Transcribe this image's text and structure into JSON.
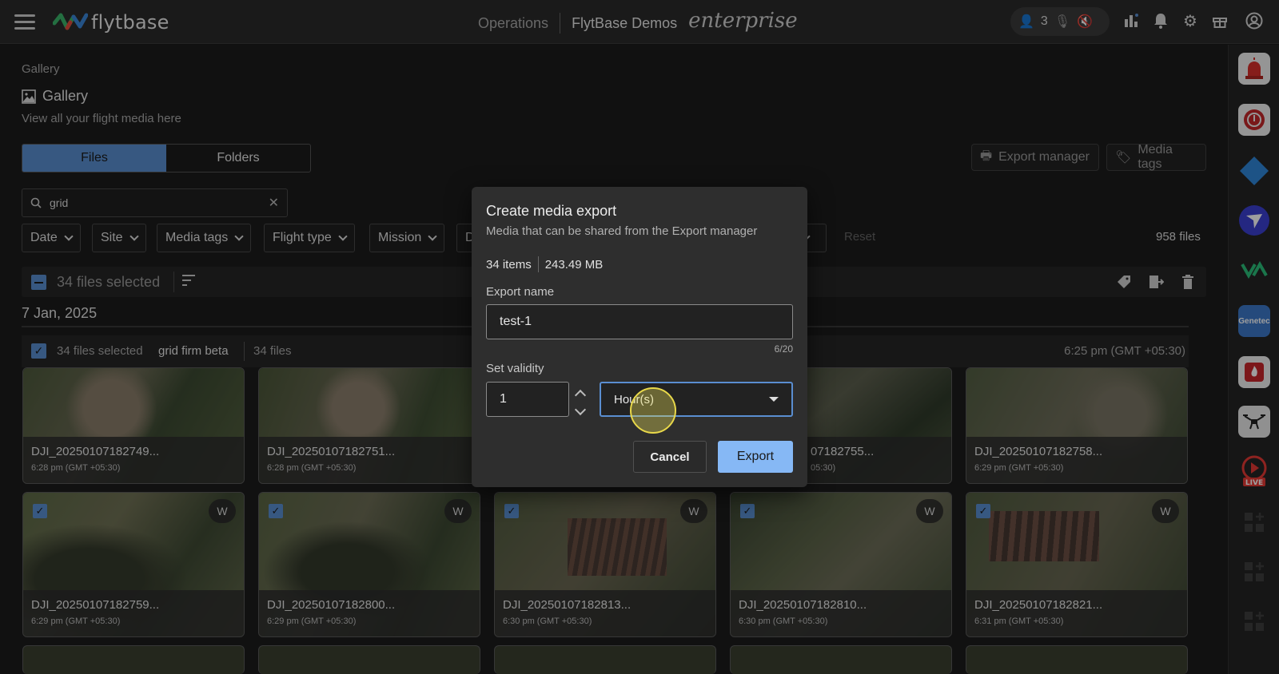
{
  "topbar": {
    "logo_text": "flytbase",
    "nav_operations": "Operations",
    "nav_org": "FlytBase Demos",
    "nav_enterprise": "enterprise",
    "user_count": "3"
  },
  "page": {
    "breadcrumb": "Gallery",
    "title": "Gallery",
    "subtitle": "View all your flight media here"
  },
  "tabs": [
    {
      "label": "Files",
      "active": true
    },
    {
      "label": "Folders",
      "active": false
    }
  ],
  "top_buttons": {
    "export_manager": "Export manager",
    "media_tags": "Media tags"
  },
  "search": {
    "value": "grid"
  },
  "filters": [
    "Date",
    "Site",
    "Media tags",
    "Flight type",
    "Mission",
    "D"
  ],
  "reset_label": "Reset",
  "file_count": "958 files",
  "selection": {
    "label": "34 files selected"
  },
  "date_heading": "7 Jan, 2025",
  "group": {
    "selected": "34 files selected",
    "name": "grid firm beta",
    "count": "34 files",
    "time": "6:25 pm (GMT +05:30)"
  },
  "cards_row1": [
    {
      "name": "DJI_20250107182749...",
      "time": "6:28 pm (GMT +05:30)"
    },
    {
      "name": "DJI_20250107182751...",
      "time": "6:28 pm (GMT +05:30)"
    },
    {
      "name": "",
      "time": ""
    },
    {
      "name": "07182755...",
      "time": "05:30)"
    },
    {
      "name": "DJI_20250107182758...",
      "time": "6:29 pm (GMT +05:30)"
    }
  ],
  "cards_row2": [
    {
      "name": "DJI_20250107182759...",
      "time": "6:29 pm (GMT +05:30)",
      "badge": "W"
    },
    {
      "name": "DJI_20250107182800...",
      "time": "6:29 pm (GMT +05:30)",
      "badge": "W"
    },
    {
      "name": "DJI_20250107182813...",
      "time": "6:30 pm (GMT +05:30)",
      "badge": "W"
    },
    {
      "name": "DJI_20250107182810...",
      "time": "6:30 pm (GMT +05:30)",
      "badge": "W"
    },
    {
      "name": "DJI_20250107182821...",
      "time": "6:31 pm (GMT +05:30)",
      "badge": "W"
    }
  ],
  "modal": {
    "title": "Create media export",
    "subtitle": "Media that can be shared from the Export manager",
    "items": "34 items",
    "size": "243.49 MB",
    "name_label": "Export name",
    "name_value": "test-1",
    "name_count": "6/20",
    "validity_label": "Set validity",
    "validity_value": "1",
    "validity_unit": "Hour(s)",
    "cancel_label": "Cancel",
    "export_label": "Export"
  },
  "colors": {
    "accent": "#5a8ed1",
    "export_button": "#86b8f5"
  }
}
